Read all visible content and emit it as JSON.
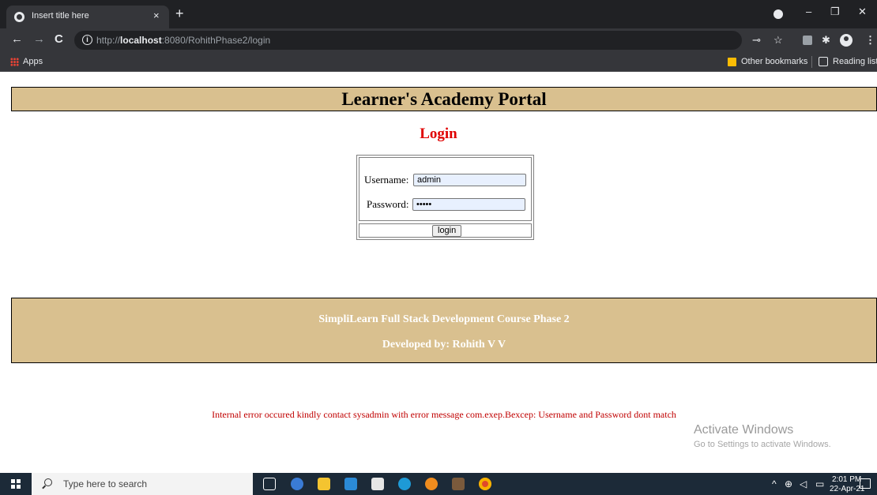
{
  "browser": {
    "tab_title": "Insert title here",
    "tab_close": "×",
    "new_tab": "+",
    "url_prefix": "http://",
    "url_host": "localhost",
    "url_rest": ":8080/RohithPhase2/login",
    "bookmarks": {
      "apps": "Apps",
      "other_bookmarks": "Other bookmarks",
      "reading_list": "Reading list"
    },
    "window_controls": {
      "minimize": "–",
      "restore": "❐",
      "close": "✕"
    }
  },
  "page": {
    "header": "Learner's Academy Portal",
    "login_title": "Login",
    "form": {
      "username_label": "Username:",
      "username_value": "admin",
      "password_label": "Password:",
      "password_value": "•••••",
      "submit_label": "login"
    },
    "footer": {
      "line1": "SimpliLearn Full Stack Development Course Phase 2",
      "line2": "Developed by: Rohith V V"
    },
    "error_message": "Internal error occured kindly contact sysadmin with error message com.exep.Bexcep: Username and Password dont match"
  },
  "watermark": {
    "title": "Activate Windows",
    "subtitle": "Go to Settings to activate Windows."
  },
  "taskbar": {
    "search_placeholder": "Type here to search",
    "time": "2:01 PM",
    "date": "22-Apr-21"
  },
  "colors": {
    "band": "#d9c08f",
    "login_title": "#e00000",
    "error": "#c00000"
  }
}
